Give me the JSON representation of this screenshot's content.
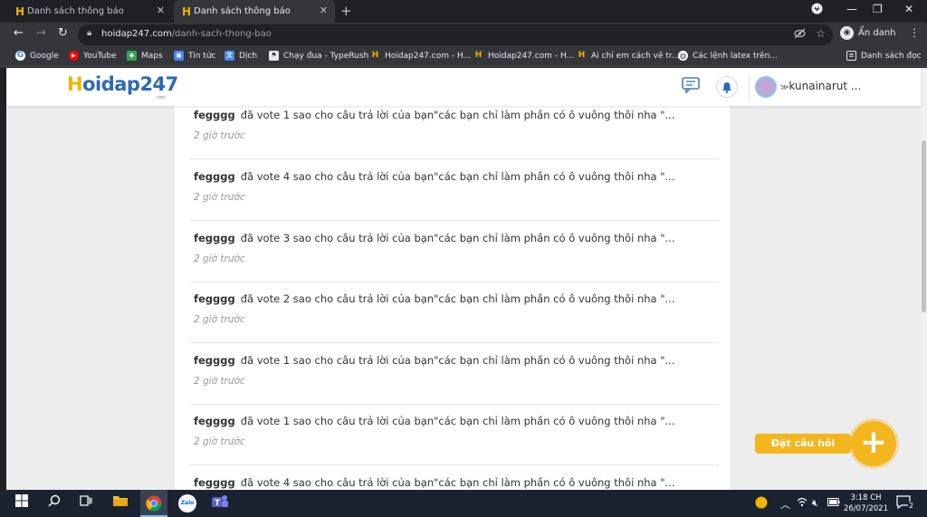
{
  "browser": {
    "tabs": [
      {
        "title": "Danh sách thông báo",
        "active": false
      },
      {
        "title": "Danh sách thông báo",
        "active": true
      }
    ],
    "url_host": "hoidap247.com",
    "url_path": "/danh-sach-thong-bao",
    "profile_label": "Ẩn danh",
    "bookmarks": [
      {
        "label": "Google",
        "icon": "google-icon"
      },
      {
        "label": "YouTube",
        "icon": "youtube-icon"
      },
      {
        "label": "Maps",
        "icon": "maps-icon"
      },
      {
        "label": "Tin tức",
        "icon": "news-icon"
      },
      {
        "label": "Dịch",
        "icon": "translate-icon"
      },
      {
        "label": "Chạy đua - TypeRush",
        "icon": "typerush-icon"
      },
      {
        "label": "Hoidap247.com - H...",
        "icon": "hoidap-icon"
      },
      {
        "label": "Hoidap247.com - H...",
        "icon": "hoidap-icon"
      },
      {
        "label": "Ai chỉ em cách vẽ tr...",
        "icon": "hoidap-icon"
      },
      {
        "label": "Các lệnh latex trên...",
        "icon": "latex-icon"
      }
    ],
    "reading_list": "Danh sách đọc"
  },
  "site": {
    "logo_h": "H",
    "logo_rest": "oidap247",
    "logo_com": ".com",
    "username": "kunainarut ..."
  },
  "notifications": [
    {
      "user": "fegggg",
      "text": "đã vote 1 sao cho câu trả lời của bạn\"các bạn chỉ làm phần có ô vuông thôi nha \"...",
      "time": "2 giờ trước"
    },
    {
      "user": "fegggg",
      "text": "đã vote 4 sao cho câu trả lời của bạn\"các bạn chỉ làm phần có ô vuông thôi nha \"...",
      "time": "2 giờ trước"
    },
    {
      "user": "fegggg",
      "text": "đã vote 3 sao cho câu trả lời của bạn\"các bạn chỉ làm phần có ô vuông thôi nha \"...",
      "time": "2 giờ trước"
    },
    {
      "user": "fegggg",
      "text": "đã vote 2 sao cho câu trả lời của bạn\"các bạn chỉ làm phần có ô vuông thôi nha \"...",
      "time": "2 giờ trước"
    },
    {
      "user": "fegggg",
      "text": "đã vote 1 sao cho câu trả lời của bạn\"các bạn chỉ làm phần có ô vuông thôi nha \"...",
      "time": "2 giờ trước"
    },
    {
      "user": "fegggg",
      "text": "đã vote 1 sao cho câu trả lời của bạn\"các bạn chỉ làm phần có ô vuông thôi nha \"...",
      "time": "2 giờ trước"
    },
    {
      "user": "fegggg",
      "text": "đã vote 4 sao cho câu trả lời của bạn\"các bạn chỉ làm phần có ô vuông thôi nha \"...",
      "time": ""
    }
  ],
  "ask_button": "Đặt câu hỏi",
  "taskbar": {
    "time": "3:18 CH",
    "date": "26/07/2021",
    "notification_count": "2"
  },
  "colors": {
    "accent_yellow": "#f3b61f",
    "brand_blue": "#2b6bb5",
    "browser_dark": "#35363a"
  }
}
